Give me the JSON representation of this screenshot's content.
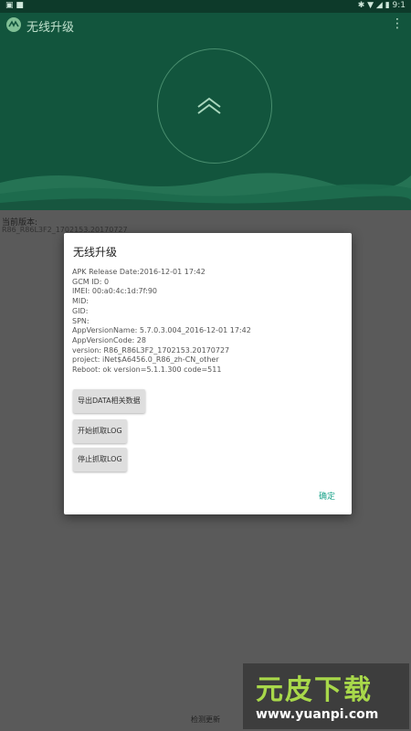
{
  "status_bar": {
    "left": "▣ ■",
    "right": "✱ ▼ ◢ ▮ 9:1"
  },
  "header": {
    "title": "无线升级",
    "menu": "⋮"
  },
  "hero": {
    "icon": "chevron-up-icon"
  },
  "current_version": {
    "label": "当前版本:",
    "value": "R86_R86L3F2_1702153.20170727"
  },
  "dialog": {
    "title": "无线升级",
    "lines": [
      "APK Release Date:2016-12-01 17:42",
      "GCM ID: 0",
      "IMEI: 00:a0:4c:1d:7f:90",
      "MID:",
      "GID:",
      "SPN:",
      "AppVersionName: 5.7.0.3.004_2016-12-01 17:42",
      "AppVersionCode: 28",
      "version: R86_R86L3F2_1702153.20170727",
      "project: iNet$A6456.0_R86_zh-CN_other",
      "Reboot: ok version=5.1.1.300 code=511"
    ],
    "buttons": {
      "export": "导出DATA相关数据",
      "start_log": "开始抓取LOG",
      "stop_log": "停止抓取LOG"
    },
    "ok": "确定"
  },
  "bottom": {
    "check_update": "检测更新"
  },
  "watermark": {
    "text": "元皮下载",
    "url": "www.yuanpi.com"
  },
  "colors": {
    "primary": "#12553d",
    "accent": "#1aa38a",
    "overlay": "#5a5a5a"
  }
}
